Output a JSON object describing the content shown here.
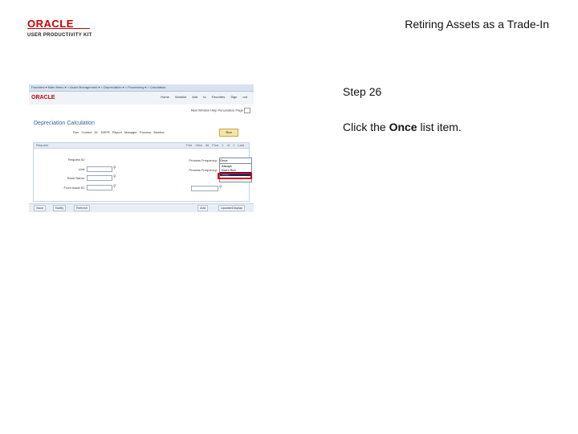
{
  "header": {
    "brand": "ORACLE",
    "brand_sub": "USER PRODUCTIVITY KIT",
    "doc_title": "Retiring Assets as a Trade-In"
  },
  "screenshot": {
    "nav_crumbs": "Favorites ▾   Main Menu ▾   > Asset Management ▾ > Depreciation ▾ > Processing ▾ > Calculation",
    "links": [
      "Home",
      "Worklist",
      "Add to Favorites",
      "Sign out"
    ],
    "links2": "New Window  Help  Personalize Page",
    "page_heading": "Depreciation Calculation",
    "fields_top": "Run Control ID: DEPR  Report Manager  Process Monitor",
    "run_label": "Run",
    "panel_title": "Request",
    "panel_tools": "Find  View All  First  1 of 1  Last",
    "labels": [
      "Request ID:",
      "Unit:",
      "Book Name:",
      "From Asset ID:",
      "Process Frequency:",
      "Process Frequency:",
      "To Asset ID:"
    ],
    "select_value": "Once",
    "dropdown_options": [
      "Always",
      "Don't Run",
      "Once"
    ],
    "buttons": [
      "Save",
      "Notify",
      "Refresh",
      "Add",
      "Update/Display"
    ]
  },
  "step": "Step 26",
  "instruction": {
    "prefix": "Click the ",
    "target": "Once",
    "suffix": " list item."
  }
}
